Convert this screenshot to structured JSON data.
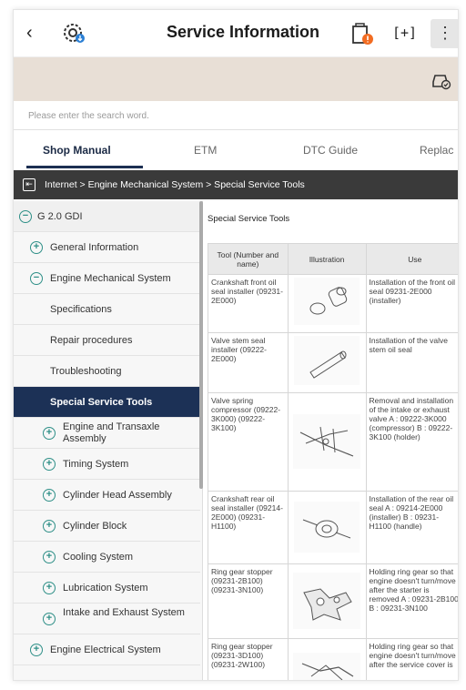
{
  "header": {
    "title": "Service Information",
    "back_icon": "back-arrow-icon",
    "more_label": "⋮"
  },
  "search": {
    "placeholder": "Please enter the search word."
  },
  "tabs": [
    {
      "label": "Shop Manual",
      "active": true
    },
    {
      "label": "ETM",
      "active": false
    },
    {
      "label": "DTC Guide",
      "active": false
    },
    {
      "label": "Replac",
      "active": false
    }
  ],
  "breadcrumb": "Internet > Engine Mechanical System > Special Service Tools",
  "sidebar": {
    "items": [
      {
        "label": "G 2.0 GDI",
        "icon": "minus"
      },
      {
        "label": "General Information",
        "icon": "plus"
      },
      {
        "label": "Engine Mechanical System",
        "icon": "minus"
      },
      {
        "label": "Specifications"
      },
      {
        "label": "Repair procedures"
      },
      {
        "label": "Troubleshooting"
      },
      {
        "label": "Special Service Tools",
        "active": true
      },
      {
        "label": "Engine and Transaxle Assembly",
        "icon": "plus"
      },
      {
        "label": "Timing System",
        "icon": "plus"
      },
      {
        "label": "Cylinder Head Assembly",
        "icon": "plus"
      },
      {
        "label": "Cylinder Block",
        "icon": "plus"
      },
      {
        "label": "Cooling System",
        "icon": "plus"
      },
      {
        "label": "Lubrication System",
        "icon": "plus"
      },
      {
        "label": "Intake and Exhaust System",
        "icon": "plus"
      },
      {
        "label": "Engine Electrical System",
        "icon": "plus"
      }
    ]
  },
  "content": {
    "title": "Special Service Tools",
    "table": {
      "headers": [
        "Tool (Number and name)",
        "Illustration",
        "Use"
      ],
      "rows": [
        {
          "tool": "Crankshaft front oil seal installer (09231-2E000)",
          "use": "Installation of the front oil seal 09231-2E000 (installer)",
          "illustration": "seal-installer-illustration"
        },
        {
          "tool": "Valve stem seal installer (09222-2E000)",
          "use": "Installation of the valve stem oil seal",
          "illustration": "valve-stem-installer-illustration"
        },
        {
          "tool": "Valve spring compressor (09222-3K000) (09222-3K100)",
          "use": "Removal and installation of the intake or exhaust valve A : 09222-3K000 (compressor) B : 09222-3K100 (holder)",
          "illustration": "spring-compressor-illustration"
        },
        {
          "tool": "Crankshaft rear oil seal installer (09214-2E000) (09231-H1100)",
          "use": "Installation of the rear oil seal A : 09214-2E000 (installer) B : 09231-H1100 (handle)",
          "illustration": "rear-seal-installer-illustration"
        },
        {
          "tool": "Ring gear stopper (09231-2B100) (09231-3N100)",
          "use": "Holding ring gear so that engine doesn't turn/move after the starter is removed A : 09231-2B100 B : 09231-3N100",
          "illustration": "ring-gear-stopper-illustration"
        },
        {
          "tool": "Ring gear stopper (09231-3D100) (09231-2W100)",
          "use": "Holding ring gear so that engine doesn't turn/move after the service cover is",
          "illustration": "ring-gear-stopper-2-illustration"
        }
      ]
    }
  },
  "colors": {
    "accent": "#1c3156",
    "banner": "#e8dfd6",
    "tree_icon": "#2e8f87",
    "breadcrumb_bg": "#3a3a3a"
  }
}
